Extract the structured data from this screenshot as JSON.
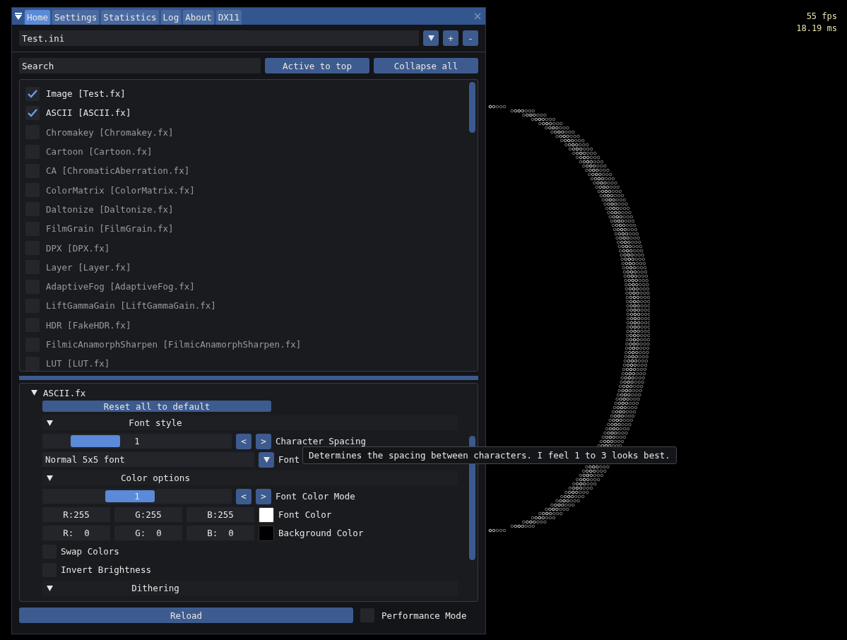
{
  "window": {
    "tabs": [
      {
        "label": "Home",
        "selected": true
      },
      {
        "label": "Settings",
        "selected": false
      },
      {
        "label": "Statistics",
        "selected": false
      },
      {
        "label": "Log",
        "selected": false
      },
      {
        "label": "About",
        "selected": false
      },
      {
        "label": "DX11",
        "selected": false
      }
    ]
  },
  "preset": {
    "value": "Test.ini",
    "buttons": [
      "+",
      "-"
    ]
  },
  "search": {
    "placeholder": "Search"
  },
  "list_buttons": [
    "Active to top",
    "Collapse all"
  ],
  "effects": [
    {
      "label": "Image [Test.fx]",
      "checked": true
    },
    {
      "label": "ASCII [ASCII.fx]",
      "checked": true
    },
    {
      "label": "Chromakey [Chromakey.fx]",
      "checked": false
    },
    {
      "label": "Cartoon [Cartoon.fx]",
      "checked": false
    },
    {
      "label": "CA [ChromaticAberration.fx]",
      "checked": false
    },
    {
      "label": "ColorMatrix [ColorMatrix.fx]",
      "checked": false
    },
    {
      "label": "Daltonize [Daltonize.fx]",
      "checked": false
    },
    {
      "label": "FilmGrain [FilmGrain.fx]",
      "checked": false
    },
    {
      "label": "DPX [DPX.fx]",
      "checked": false
    },
    {
      "label": "Layer [Layer.fx]",
      "checked": false
    },
    {
      "label": "AdaptiveFog [AdaptiveFog.fx]",
      "checked": false
    },
    {
      "label": "LiftGammaGain [LiftGammaGain.fx]",
      "checked": false
    },
    {
      "label": "HDR [FakeHDR.fx]",
      "checked": false
    },
    {
      "label": "FilmicAnamorphSharpen [FilmicAnamorphSharpen.fx]",
      "checked": false
    },
    {
      "label": "LUT [LUT.fx]",
      "checked": false
    }
  ],
  "effect_settings": {
    "title": "ASCII.fx",
    "expanded": true,
    "reset": "Reset all to default",
    "controls": [
      {
        "kind": "header",
        "title": "Font style",
        "expanded": true
      },
      {
        "kind": "slider",
        "value": "1",
        "level": 0.2,
        "dec": "<",
        "inc": ">",
        "label": "Character Spacing"
      },
      {
        "kind": "combo",
        "value": "Normal 5x5 font",
        "label": "Font"
      },
      {
        "kind": "header",
        "title": "Color options",
        "expanded": true
      },
      {
        "kind": "slider",
        "value": "1",
        "level": 0.45,
        "dec": "<",
        "inc": ">",
        "label": "Font Color Mode"
      },
      {
        "kind": "color",
        "channels": [
          "R:255",
          "G:255",
          "B:255"
        ],
        "color": "#ffffff",
        "label": "Font Color"
      },
      {
        "kind": "color",
        "channels": [
          "R:  0",
          "G:  0",
          "B:  0"
        ],
        "color": "#000000",
        "label": "Background Color"
      },
      {
        "kind": "checkbox",
        "label": "Swap Colors",
        "checked": false
      },
      {
        "kind": "checkbox",
        "label": "Invert Brightness",
        "checked": false
      },
      {
        "kind": "header",
        "title": "Dithering",
        "expanded": true
      }
    ]
  },
  "tooltip": "Determines the spacing between characters. I feel 1 to 3 looks best.",
  "footer": {
    "reload": "Reload",
    "performance_mode": {
      "label": "Performance Mode",
      "checked": false
    }
  },
  "overlay": {
    "fps": "55 fps",
    "frame_time": "18.19 ms"
  }
}
